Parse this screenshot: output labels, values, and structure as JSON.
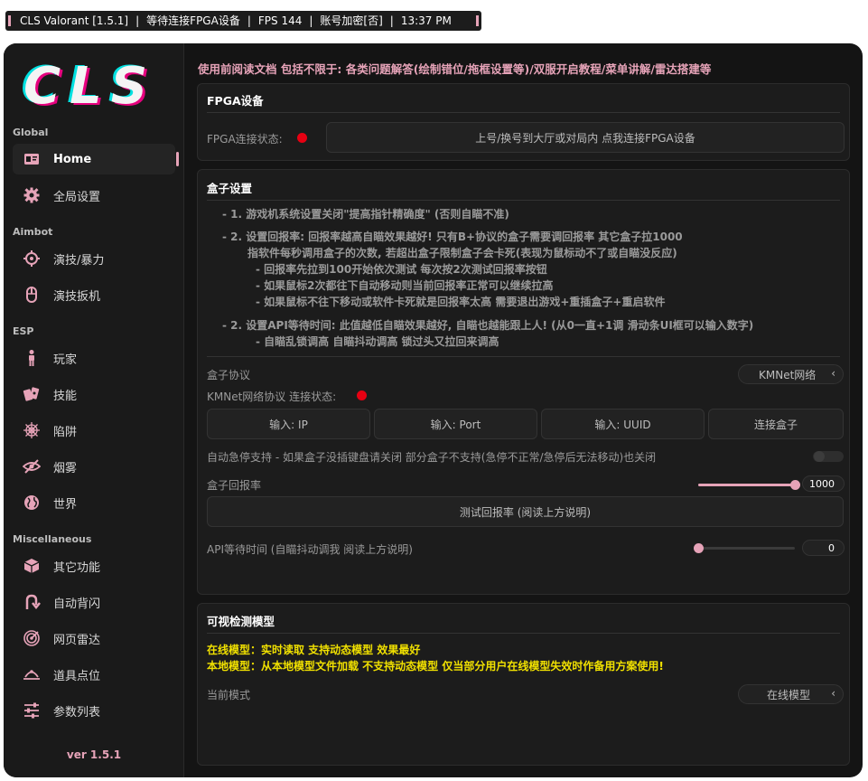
{
  "titlebar": {
    "app": "CLS Valorant [1.5.1]",
    "status": "等待连接FPGA设备",
    "fps": "FPS 144",
    "account": "账号加密[否]",
    "time": "13:37 PM",
    "separator": "|"
  },
  "sidebar": {
    "logo_text": "CLS",
    "sections": {
      "global": "Global",
      "aimbot": "Aimbot",
      "esp": "ESP",
      "misc": "Miscellaneous"
    },
    "items": [
      {
        "label": "Home",
        "icon": "id-card-icon"
      },
      {
        "label": "全局设置",
        "icon": "gear-icon"
      },
      {
        "label": "演技/暴力",
        "icon": "crosshair-icon"
      },
      {
        "label": "演技扳机",
        "icon": "mouse-icon"
      },
      {
        "label": "玩家",
        "icon": "person-icon"
      },
      {
        "label": "技能",
        "icon": "cards-icon"
      },
      {
        "label": "陷阱",
        "icon": "spider-web-icon"
      },
      {
        "label": "烟雾",
        "icon": "eye-slash-icon"
      },
      {
        "label": "世界",
        "icon": "globe-icon"
      },
      {
        "label": "其它功能",
        "icon": "cube-icon"
      },
      {
        "label": "自动背闪",
        "icon": "u-turn-icon"
      },
      {
        "label": "网页雷达",
        "icon": "radar-icon"
      },
      {
        "label": "道具点位",
        "icon": "location-icon"
      },
      {
        "label": "参数列表",
        "icon": "sliders-icon"
      }
    ],
    "version": "ver 1.5.1"
  },
  "notice": "使用前阅读文档  包括不限于: 各类问题解答(绘制错位/拖框设置等)/双服开启教程/菜单讲解/雷达搭建等",
  "fpga": {
    "title": "FPGA设备",
    "status_label": "FPGA连接状态:",
    "connect_button": "上号/换号到大厅或对局内 点我连接FPGA设备"
  },
  "box": {
    "title": "盒子设置",
    "instructions": [
      "- 1. 游戏机系统设置关闭\"提高指针精确度\" (否则自瞄不准)",
      "- 2. 设置回报率: 回报率越高自瞄效果越好! 只有B+协议的盒子需要调回报率 其它盒子拉1000",
      "指软件每秒调用盒子的次数, 若超出盒子限制盒子会卡死(表现为鼠标动不了或自瞄没反应)",
      "- 回报率先拉到100开始依次测试 每次按2次测试回报率按钮",
      "- 如果鼠标2次都往下自动移动则当前回报率正常可以继续拉高",
      "- 如果鼠标不往下移动或软件卡死就是回报率太高 需要退出游戏+重插盒子+重启软件",
      "- 2. 设置API等待时间: 此值越低自瞄效果越好, 自瞄也越能跟上人!  (从0一直+1调 滑动条UI框可以输入数字)",
      "- 自瞄乱锁调高  自瞄抖动调高  锁过头又拉回来调高"
    ],
    "protocol_label": "盒子协议",
    "protocol_value": "KMNet网络",
    "kmnet_status_label": "KMNet网络协议 连接状态:",
    "input_ip": "输入: IP",
    "input_port": "输入: Port",
    "input_uuid": "输入: UUID",
    "connect_box": "连接盒子",
    "auto_stop_label": "自动急停支持 - 如果盒子没插键盘请关闭 部分盒子不支持(急停不正常/急停后无法移动)也关闭",
    "auto_stop_enabled": false,
    "rate_label": "盒子回报率",
    "rate_value": "1000",
    "rate_fraction": 1.0,
    "test_rate_button": "测试回报率 (阅读上方说明)",
    "api_label": "API等待时间 (自瞄抖动调我 阅读上方说明)",
    "api_value": "0",
    "api_fraction": 0.0
  },
  "visual": {
    "title": "可视检测模型",
    "online_desc": "在线模型：实时读取 支持动态模型 效果最好",
    "local_desc": "本地模型：从本地模型文件加载 不支持动态模型 仅当部分用户在线模型失效时作备用方案使用!",
    "mode_label": "当前模式",
    "mode_value": "在线模型"
  },
  "colors": {
    "accent": "#e6a3b8",
    "status_red": "#e60012",
    "warning_yellow": "#f0e000",
    "background": "#141414"
  }
}
